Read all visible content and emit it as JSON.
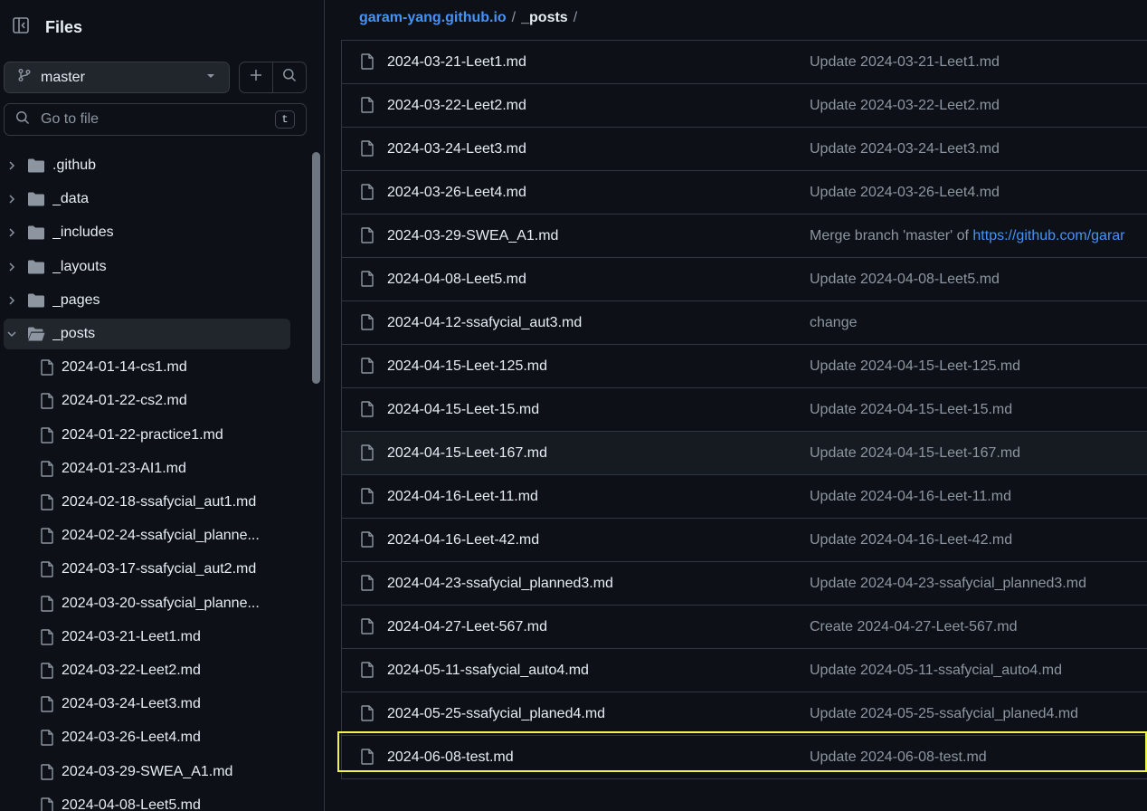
{
  "sidebar": {
    "title": "Files",
    "branch": "master",
    "goto_placeholder": "Go to file",
    "goto_shortcut": "t",
    "tree": [
      {
        "type": "folder",
        "label": ".github",
        "expanded": false
      },
      {
        "type": "folder",
        "label": "_data",
        "expanded": false
      },
      {
        "type": "folder",
        "label": "_includes",
        "expanded": false
      },
      {
        "type": "folder",
        "label": "_layouts",
        "expanded": false
      },
      {
        "type": "folder",
        "label": "_pages",
        "expanded": false
      },
      {
        "type": "folder",
        "label": "_posts",
        "expanded": true,
        "active": true
      },
      {
        "type": "file",
        "label": "2024-01-14-cs1.md"
      },
      {
        "type": "file",
        "label": "2024-01-22-cs2.md"
      },
      {
        "type": "file",
        "label": "2024-01-22-practice1.md"
      },
      {
        "type": "file",
        "label": "2024-01-23-AI1.md"
      },
      {
        "type": "file",
        "label": "2024-02-18-ssafycial_aut1.md"
      },
      {
        "type": "file",
        "label": "2024-02-24-ssafycial_planne..."
      },
      {
        "type": "file",
        "label": "2024-03-17-ssafycial_aut2.md"
      },
      {
        "type": "file",
        "label": "2024-03-20-ssafycial_planne..."
      },
      {
        "type": "file",
        "label": "2024-03-21-Leet1.md"
      },
      {
        "type": "file",
        "label": "2024-03-22-Leet2.md"
      },
      {
        "type": "file",
        "label": "2024-03-24-Leet3.md"
      },
      {
        "type": "file",
        "label": "2024-03-26-Leet4.md"
      },
      {
        "type": "file",
        "label": "2024-03-29-SWEA_A1.md"
      },
      {
        "type": "file",
        "label": "2024-04-08-Leet5.md"
      }
    ]
  },
  "breadcrumb": {
    "repo": "garam-yang.github.io",
    "separator": "/",
    "current": "_posts",
    "trailing": "/"
  },
  "files": [
    {
      "name": "2024-03-21-Leet1.md",
      "commit": "Update 2024-03-21-Leet1.md"
    },
    {
      "name": "2024-03-22-Leet2.md",
      "commit": "Update 2024-03-22-Leet2.md"
    },
    {
      "name": "2024-03-24-Leet3.md",
      "commit": "Update 2024-03-24-Leet3.md"
    },
    {
      "name": "2024-03-26-Leet4.md",
      "commit": "Update 2024-03-26-Leet4.md"
    },
    {
      "name": "2024-03-29-SWEA_A1.md",
      "commit": "Merge branch 'master' of ",
      "commit_link": "https://github.com/garar"
    },
    {
      "name": "2024-04-08-Leet5.md",
      "commit": "Update 2024-04-08-Leet5.md"
    },
    {
      "name": "2024-04-12-ssafycial_aut3.md",
      "commit": "change"
    },
    {
      "name": "2024-04-15-Leet-125.md",
      "commit": "Update 2024-04-15-Leet-125.md"
    },
    {
      "name": "2024-04-15-Leet-15.md",
      "commit": "Update 2024-04-15-Leet-15.md"
    },
    {
      "name": "2024-04-15-Leet-167.md",
      "commit": "Update 2024-04-15-Leet-167.md",
      "hover": true
    },
    {
      "name": "2024-04-16-Leet-11.md",
      "commit": "Update 2024-04-16-Leet-11.md"
    },
    {
      "name": "2024-04-16-Leet-42.md",
      "commit": "Update 2024-04-16-Leet-42.md"
    },
    {
      "name": "2024-04-23-ssafycial_planned3.md",
      "commit": "Update 2024-04-23-ssafycial_planned3.md"
    },
    {
      "name": "2024-04-27-Leet-567.md",
      "commit": "Create 2024-04-27-Leet-567.md"
    },
    {
      "name": "2024-05-11-ssafycial_auto4.md",
      "commit": "Update 2024-05-11-ssafycial_auto4.md"
    },
    {
      "name": "2024-05-25-ssafycial_planed4.md",
      "commit": "Update 2024-05-25-ssafycial_planed4.md"
    },
    {
      "name": "2024-06-08-test.md",
      "commit": "Update 2024-06-08-test.md",
      "selected": true
    }
  ],
  "colors": {
    "background": "#0d1117",
    "link": "#4493f8",
    "muted": "#8d96a0",
    "highlight": "#f0f34a"
  }
}
